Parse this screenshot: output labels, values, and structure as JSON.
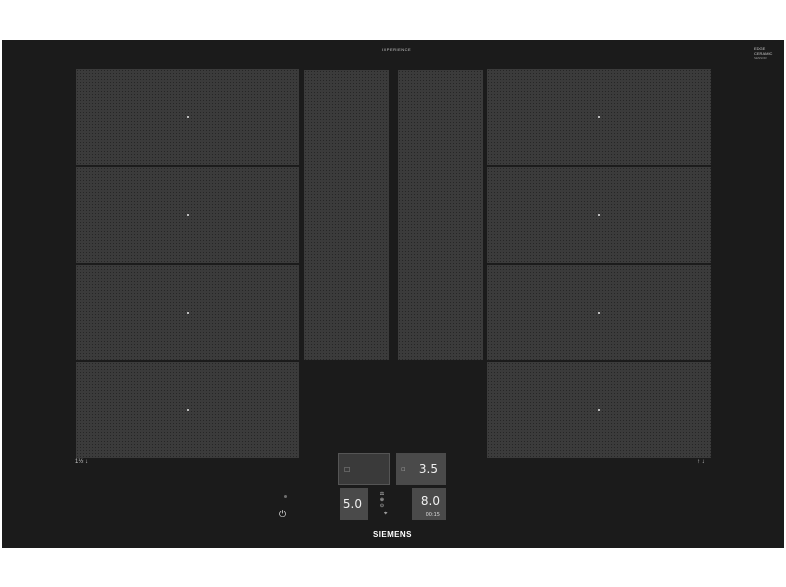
{
  "hob": {
    "model_label": "IXPERIENCE",
    "brand": "SIEMENS",
    "badge": {
      "line1": "EDGE",
      "line2": "CERAMIC",
      "line3": "SENSOR"
    }
  },
  "markers": {
    "left": "1½ ↓",
    "right": "↑ ↓"
  },
  "controls": {
    "top_left_display": "",
    "top_left_icon": "☐",
    "top_right_icon": "▫",
    "top_right_value": "3.5",
    "bottom_left_value": "5.0",
    "bottom_right_value": "8.0",
    "bottom_right_timer": "00:15",
    "mid_icon_1": "⚖",
    "mid_icon_2": "⊕",
    "mid_icon_3": "⊙",
    "bottom_icon": "⌖",
    "power_icon": "⏻"
  },
  "colors": {
    "surface": "#1b1b1b",
    "zone": "#3b3b3b",
    "display": "#4a4a4a"
  }
}
